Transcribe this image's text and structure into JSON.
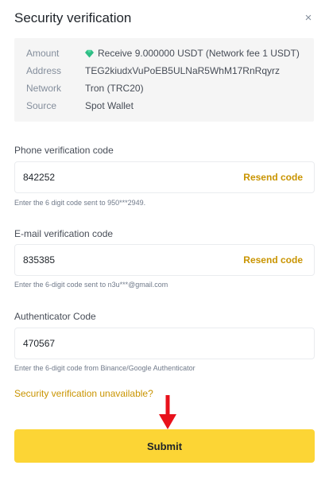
{
  "dialog": {
    "title": "Security verification",
    "close_symbol": "×"
  },
  "summary": {
    "amount_label": "Amount",
    "amount_value": "Receive 9.000000 USDT (Network fee 1 USDT)",
    "amount_icon": "usdt-gem-icon",
    "address_label": "Address",
    "address_value": "TEG2kiudxVuPoEB5ULNaR5WhM17RnRqyrz",
    "network_label": "Network",
    "network_value": "Tron (TRC20)",
    "source_label": "Source",
    "source_value": "Spot Wallet"
  },
  "phone": {
    "label": "Phone verification code",
    "value": "842252",
    "resend_label": "Resend code",
    "hint": "Enter the 6 digit code sent to 950***2949."
  },
  "email": {
    "label": "E-mail verification code",
    "value": "835385",
    "resend_label": "Resend code",
    "hint": "Enter the 6-digit code sent to n3u***@gmail.com"
  },
  "authenticator": {
    "label": "Authenticator Code",
    "value": "470567",
    "hint": "Enter the 6-digit code from Binance/Google Authenticator"
  },
  "unavailable_link": "Security verification unavailable?",
  "submit_label": "Submit",
  "colors": {
    "accent_yellow": "#fcd535",
    "link_gold": "#c99400",
    "gem_green": "#2ebd85",
    "arrow_red": "#e8111b"
  }
}
